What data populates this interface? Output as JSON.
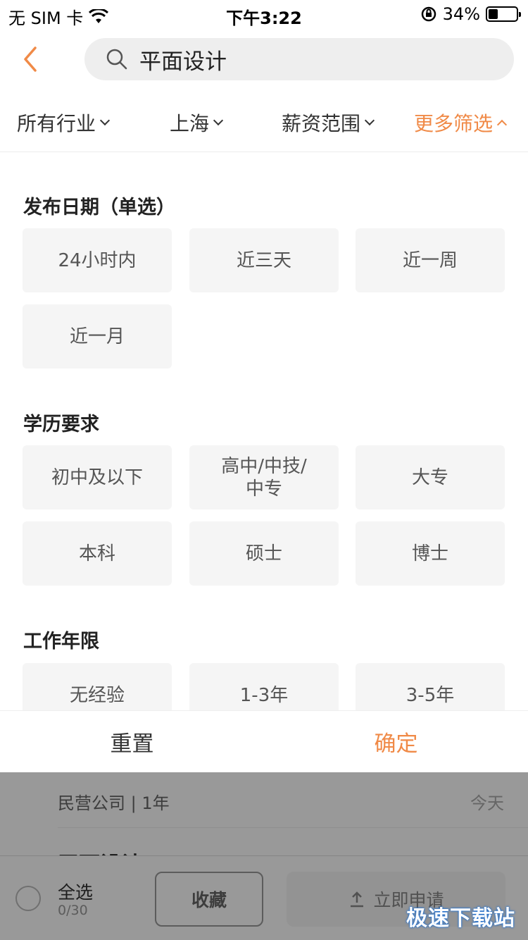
{
  "status_bar": {
    "carrier": "无 SIM 卡",
    "time": "下午3:22",
    "battery_pct": "34%",
    "battery_level": 0.34
  },
  "search": {
    "query": "平面设计"
  },
  "filter_tabs": [
    {
      "label": "所有行业",
      "active": false
    },
    {
      "label": "上海",
      "active": false
    },
    {
      "label": "薪资范围",
      "active": false
    },
    {
      "label": "更多筛选",
      "active": true
    }
  ],
  "sections": [
    {
      "title": "发布日期（单选）",
      "options": [
        "24小时内",
        "近三天",
        "近一周",
        "近一月"
      ]
    },
    {
      "title": "学历要求",
      "options": [
        "初中及以下",
        "高中/中技/\n中专",
        "大专",
        "本科",
        "硕士",
        "博士"
      ]
    },
    {
      "title": "工作年限",
      "options": [
        "无经验",
        "1-3年",
        "3-5年"
      ]
    }
  ],
  "actions": {
    "reset": "重置",
    "confirm": "确定"
  },
  "background_list": {
    "company_type": "民营公司 | 1年",
    "date": "今天",
    "next_title": "平面设计"
  },
  "bottom_bar": {
    "select_all": "全选",
    "count": "0/30",
    "favorite": "收藏",
    "apply": "立即申请"
  },
  "watermark": "极速下载站",
  "colors": {
    "accent": "#f08a47",
    "chip_bg": "#f5f5f5"
  }
}
